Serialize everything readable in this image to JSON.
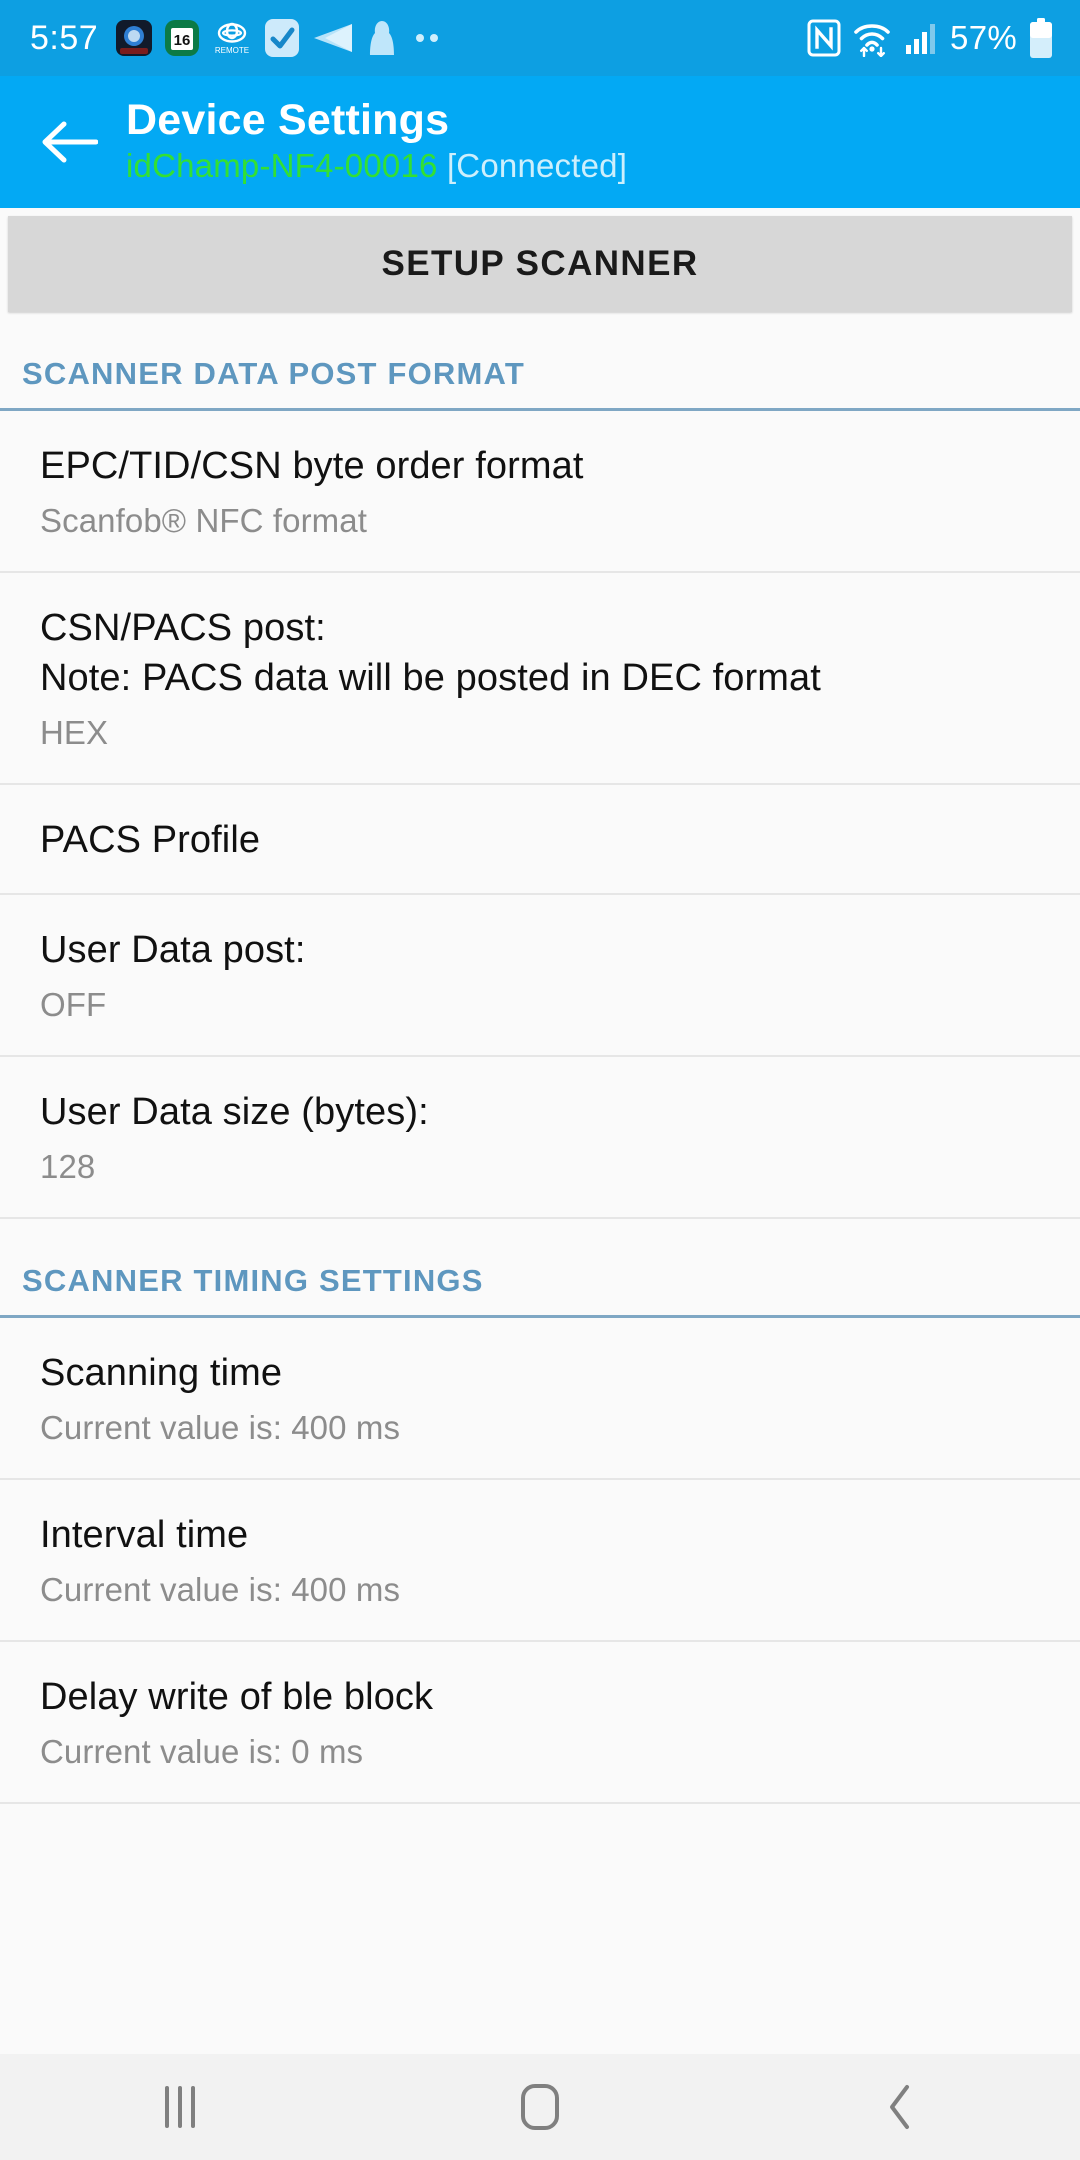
{
  "status_bar": {
    "time": "5:57",
    "battery_percent": "57%",
    "left_icons": [
      "camera-app-icon",
      "calendar-16-icon",
      "toyota-remote-icon",
      "checkmark-app-icon",
      "paper-plane-icon",
      "person-app-icon",
      "more-dots-icon"
    ],
    "calendar_day": "16",
    "toyota_label": "REMOTE",
    "right_icons": [
      "nfc-icon",
      "wifi-icon",
      "cellular-signal-icon",
      "battery-icon"
    ]
  },
  "app_bar": {
    "back_icon": "back-arrow-icon",
    "title": "Device Settings",
    "device_name": "idChamp-NF4-00016",
    "connection_state": "[Connected]"
  },
  "setup": {
    "button_label": "SETUP SCANNER"
  },
  "sections": [
    {
      "header": "SCANNER DATA POST FORMAT",
      "items": [
        {
          "title": "EPC/TID/CSN byte order format",
          "title_line2": "",
          "subtitle": "Scanfob® NFC format"
        },
        {
          "title": "CSN/PACS post:",
          "title_line2": "Note: PACS data will be posted in DEC format",
          "subtitle": "HEX"
        },
        {
          "title": "PACS Profile",
          "title_line2": "",
          "subtitle": ""
        },
        {
          "title": "User Data post:",
          "title_line2": "",
          "subtitle": "OFF"
        },
        {
          "title": "User Data size (bytes):",
          "title_line2": "",
          "subtitle": "128"
        }
      ]
    },
    {
      "header": "SCANNER TIMING SETTINGS",
      "items": [
        {
          "title": "Scanning time",
          "title_line2": "",
          "subtitle": "Current value is: 400 ms"
        },
        {
          "title": "Interval time",
          "title_line2": "",
          "subtitle": "Current value is: 400 ms"
        },
        {
          "title": "Delay write of ble block",
          "title_line2": "",
          "subtitle": "Current value is: 0 ms"
        }
      ]
    }
  ],
  "nav_bar": {
    "recents_icon": "recents-icon",
    "home_icon": "home-icon",
    "back_icon": "nav-back-icon"
  },
  "colors": {
    "status_bar_bg": "#0d9fe2",
    "app_bar_bg": "#03a9f4",
    "device_name": "#33e033",
    "section_header": "#5e97bf",
    "setup_button_bg": "#d7d7d7",
    "page_bg": "#fafafa"
  }
}
